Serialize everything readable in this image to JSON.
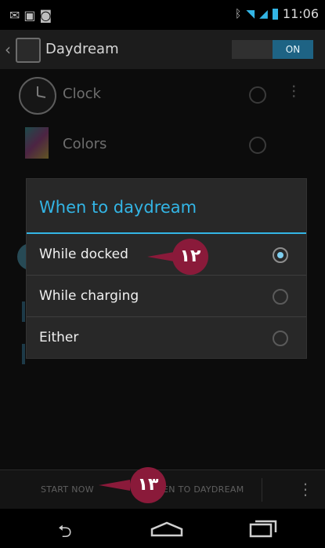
{
  "status_bar": {
    "left_icons": [
      "mail-icon",
      "image-icon",
      "game-controller-icon"
    ],
    "right_icons": [
      "bluetooth-icon",
      "wifi-icon",
      "signal-icon",
      "battery-icon"
    ],
    "time": "11:06"
  },
  "action_bar": {
    "title": "Daydream",
    "toggle_label": "ON"
  },
  "list": {
    "items": [
      {
        "label": "Clock",
        "icon": "clock-icon"
      },
      {
        "label": "Colors",
        "icon": "colors-icon"
      }
    ]
  },
  "dialog": {
    "title": "When to daydream",
    "options": [
      {
        "label": "While docked",
        "selected": true
      },
      {
        "label": "While charging",
        "selected": false
      },
      {
        "label": "Either",
        "selected": false
      }
    ]
  },
  "callouts": {
    "first": "١٢",
    "second": "١٣"
  },
  "bottom_bar": {
    "start_now": "START NOW",
    "when_to_daydream": "EN TO DAYDREAM"
  },
  "colors": {
    "accent": "#33b5e5",
    "callout": "#8a1a3a"
  }
}
